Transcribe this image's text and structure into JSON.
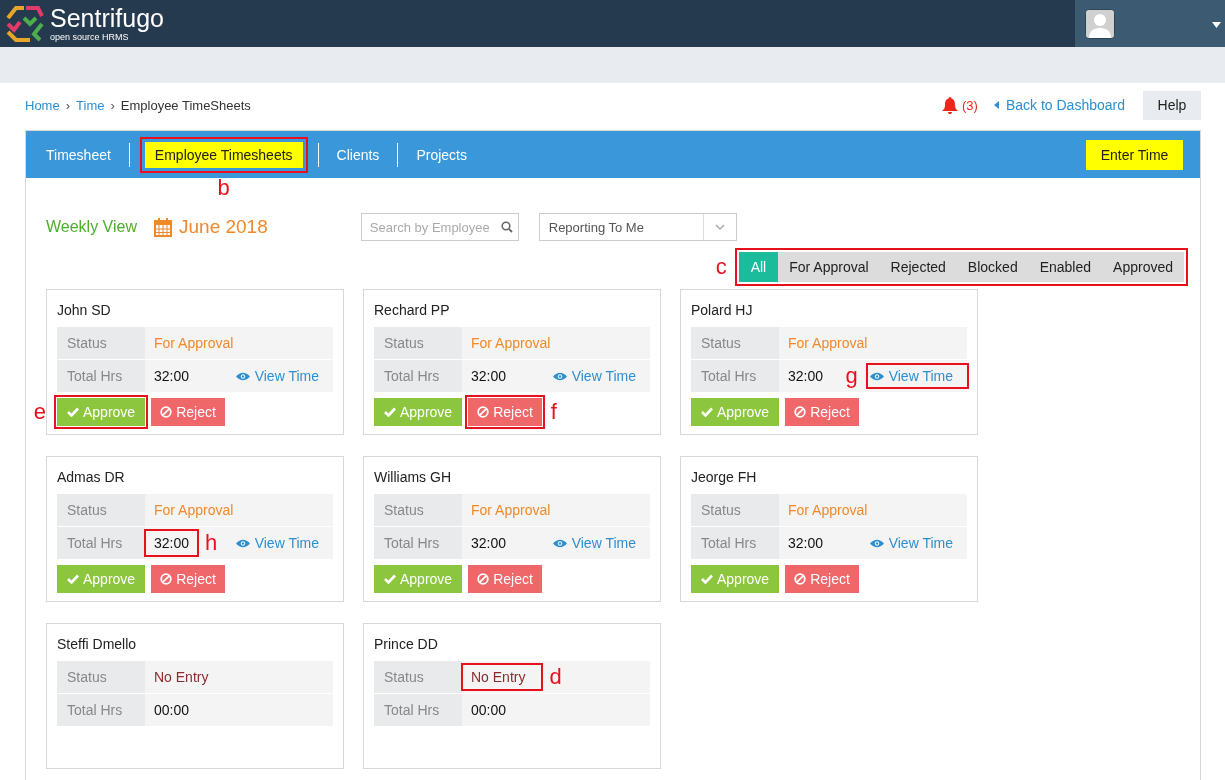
{
  "header": {
    "brand": "Sentrifugo",
    "tagline": "open source HRMS"
  },
  "breadcrumb": {
    "links": [
      "Home",
      "Time"
    ],
    "current": "Employee TimeSheets"
  },
  "breadcrumb_separators": [
    "›",
    "›"
  ],
  "notifications": {
    "count": "(3)"
  },
  "back_link": "Back to Dashboard",
  "help_button": "Help",
  "tabs": [
    {
      "label": "Timesheet",
      "selected": false
    },
    {
      "label": "Employee Timesheets",
      "selected": true,
      "callout": "b"
    },
    {
      "label": "Clients",
      "selected": false
    },
    {
      "label": "Projects",
      "selected": false
    }
  ],
  "enter_time_button": "Enter Time",
  "view_label": "Weekly View",
  "period": "June 2018",
  "search": {
    "placeholder": "Search by Employee"
  },
  "reporting_select": {
    "value": "Reporting To Me"
  },
  "filters": {
    "callout": "c",
    "items": [
      {
        "label": "All",
        "selected": true
      },
      {
        "label": "For Approval",
        "selected": false
      },
      {
        "label": "Rejected",
        "selected": false
      },
      {
        "label": "Blocked",
        "selected": false
      },
      {
        "label": "Enabled",
        "selected": false
      },
      {
        "label": "Approved",
        "selected": false
      }
    ]
  },
  "cards": [
    {
      "name": "John SD",
      "status_label": "Status",
      "status": {
        "text": "For Approval",
        "kind": "pending"
      },
      "hours_label": "Total Hrs",
      "hours": "32:00",
      "view_time": "View Time",
      "approve": "Approve",
      "reject": "Reject",
      "approve_callout": "e"
    },
    {
      "name": "Rechard PP",
      "status_label": "Status",
      "status": {
        "text": "For Approval",
        "kind": "pending"
      },
      "hours_label": "Total Hrs",
      "hours": "32:00",
      "view_time": "View Time",
      "approve": "Approve",
      "reject": "Reject",
      "reject_callout": "f"
    },
    {
      "name": "Polard HJ",
      "status_label": "Status",
      "status": {
        "text": "For Approval",
        "kind": "pending"
      },
      "hours_label": "Total Hrs",
      "hours": "32:00",
      "view_time": "View Time",
      "approve": "Approve",
      "reject": "Reject",
      "view_callout": "g"
    },
    {
      "name": "Admas DR",
      "status_label": "Status",
      "status": {
        "text": "For Approval",
        "kind": "pending"
      },
      "hours_label": "Total Hrs",
      "hours": "32:00",
      "view_time": "View Time",
      "approve": "Approve",
      "reject": "Reject",
      "hours_callout": "h"
    },
    {
      "name": "Williams GH",
      "status_label": "Status",
      "status": {
        "text": "For Approval",
        "kind": "pending"
      },
      "hours_label": "Total Hrs",
      "hours": "32:00",
      "view_time": "View Time",
      "approve": "Approve",
      "reject": "Reject"
    },
    {
      "name": "Jeorge FH",
      "status_label": "Status",
      "status": {
        "text": "For Approval",
        "kind": "pending"
      },
      "hours_label": "Total Hrs",
      "hours": "32:00",
      "view_time": "View Time",
      "approve": "Approve",
      "reject": "Reject"
    },
    {
      "name": "Steffi Dmello",
      "status_label": "Status",
      "status": {
        "text": "No Entry",
        "kind": "none"
      },
      "hours_label": "Total Hrs",
      "hours": "00:00"
    },
    {
      "name": "Prince DD",
      "status_label": "Status",
      "status": {
        "text": "No Entry",
        "kind": "none",
        "callout": "d"
      },
      "hours_label": "Total Hrs",
      "hours": "00:00"
    }
  ]
}
